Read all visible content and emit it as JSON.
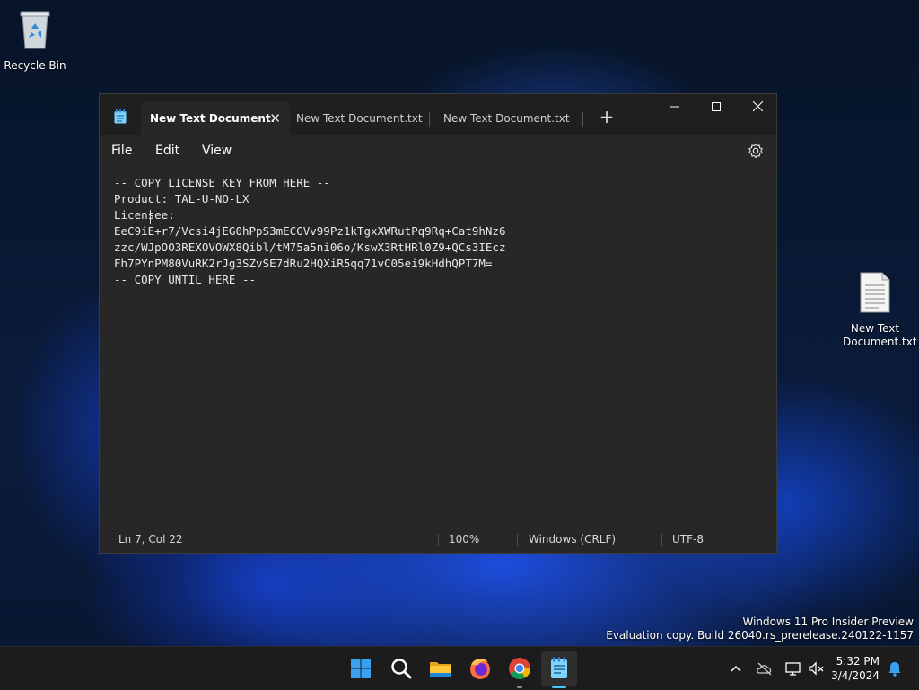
{
  "desktop": {
    "recycle_bin_label": "Recycle Bin",
    "text_file_label": "New Text Document.txt"
  },
  "notepad": {
    "tabs": [
      {
        "label": "New Text Document.",
        "active": true
      },
      {
        "label": "New Text Document.txt",
        "active": false
      },
      {
        "label": "New Text Document.txt",
        "active": false
      }
    ],
    "new_tab_symbol": "+",
    "window_controls": {
      "minimize": "—",
      "maximize": "☐",
      "close": "✕"
    },
    "menu": {
      "file": "File",
      "edit": "Edit",
      "view": "View"
    },
    "content": "-- COPY LICENSE KEY FROM HERE --\nProduct: TAL-U-NO-LX\nLicensee:\nEeC9iE+r7/Vcsi4jEG0hPpS3mECGVv99Pz1kTgxXWRutPq9Rq+Cat9hNz6\nzzc/WJpOO3REXOVOWX8Qibl/tM75a5ni06o/KswX3RtHRl0Z9+QCs3IEcz\nFh7PYnPM80VuRK2rJg3SZvSE7dRu2HQXiR5qq71vC05ei9kHdhQPT7M=\n-- COPY UNTIL HERE --",
    "status": {
      "position": "Ln 7, Col 22",
      "zoom": "100%",
      "line_ending": "Windows (CRLF)",
      "encoding": "UTF-8"
    }
  },
  "watermark": {
    "line1": "Windows 11 Pro Insider Preview",
    "line2": "Evaluation copy. Build 26040.rs_prerelease.240122-1157"
  },
  "taskbar": {
    "apps": [
      "start-icon",
      "search-icon",
      "file-explorer-icon",
      "firefox-icon",
      "chrome-icon",
      "notepad-icon"
    ],
    "clock_time": "5:32 PM",
    "clock_date": "3/4/2024",
    "tray_icons": [
      "chevron-up-icon",
      "onedrive-icon",
      "network-icon",
      "volume-muted-icon",
      "notification-bell-icon"
    ],
    "colors": {
      "accent": "#4cc2ff",
      "running": "#8a8a8a"
    }
  }
}
